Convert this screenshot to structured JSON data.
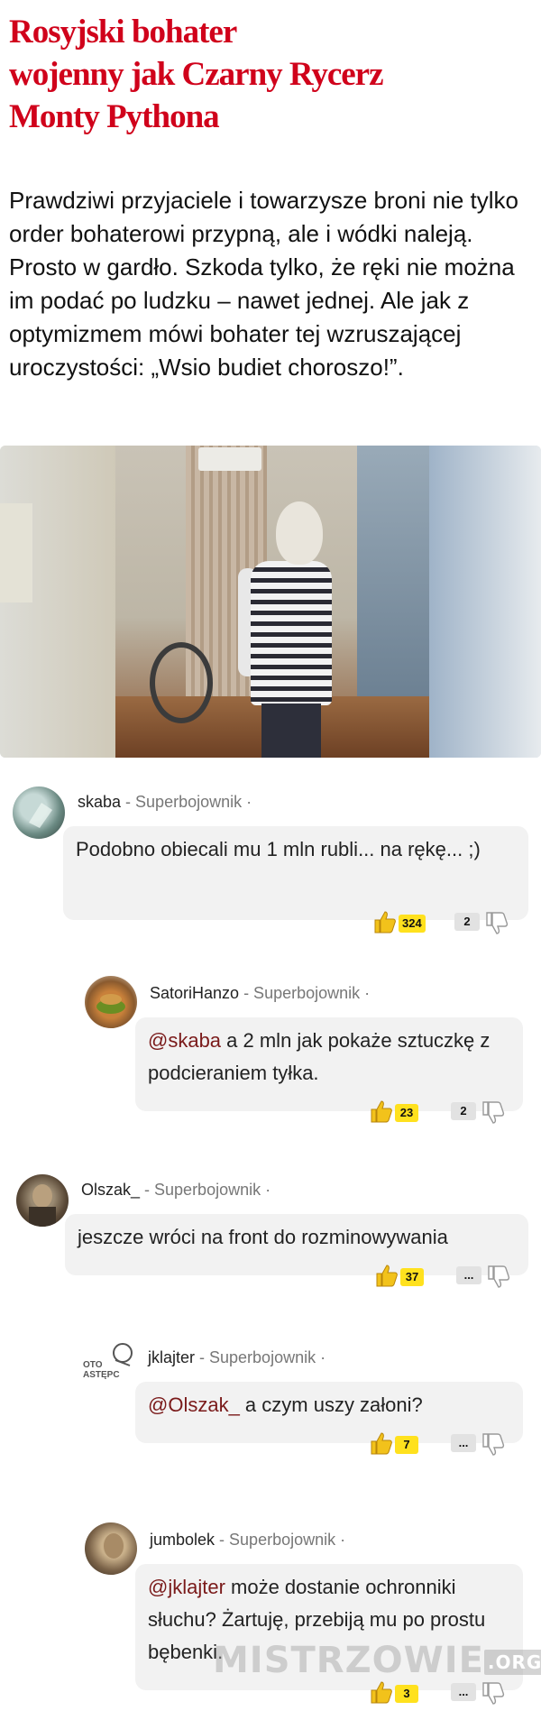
{
  "article": {
    "title": "Rosyjski bohater\nwojenny jak Czarny Rycerz\nMonty Pythona",
    "lead": "Prawdziwi przyjaciele i towarzysze broni nie tylko order bohaterowi przypną, ale i wódki naleją. Prosto w gardło. Szkoda tylko, że ręki nie można im podać po ludzku – nawet jednej. Ale jak z optymizmem mówi bohater tej wzruszającej uroczystości: „Wsio budiet choroszo!”."
  },
  "comments": [
    {
      "author": "skaba",
      "rank": " - Superbojownik ·",
      "mention": "",
      "text": "Podobno obiecali mu 1 mln rubli... na rękę... ;)",
      "upvotes": "324",
      "downvotes": "2"
    },
    {
      "author": "SatoriHanzo",
      "rank": " - Superbojownik ·",
      "mention": "@skaba",
      "text": " a 2 mln jak pokaże sztuczkę z podcieraniem tyłka.",
      "upvotes": "23",
      "downvotes": "2"
    },
    {
      "author": "Olszak_",
      "rank": " - Superbojownik ·",
      "mention": "",
      "text": "jeszcze wróci na front do rozminowywania",
      "upvotes": "37",
      "downvotes": "..."
    },
    {
      "author": "jklajter",
      "rank": " - Superbojownik ·",
      "mention": "@Olszak_",
      "text": "  a czym uszy załoni?",
      "upvotes": "7",
      "downvotes": "..."
    },
    {
      "author": "jumbolek",
      "rank": " - Superbojownik ·",
      "mention": "@jklajter",
      "text": " może dostanie ochronniki słuchu? Żartuję, przebiją mu po prostu bębenki.",
      "upvotes": "3",
      "downvotes": "..."
    }
  ],
  "avatars": {
    "jklajter_text": "OTO\nASTĘPC"
  },
  "watermark": {
    "text": "MISTRZOWIE",
    "org": ".ORG"
  },
  "colors": {
    "title": "#d0021b",
    "mention": "#7a1a1a",
    "vote_badge": "#ffe11e",
    "bubble": "#f2f2f2"
  }
}
